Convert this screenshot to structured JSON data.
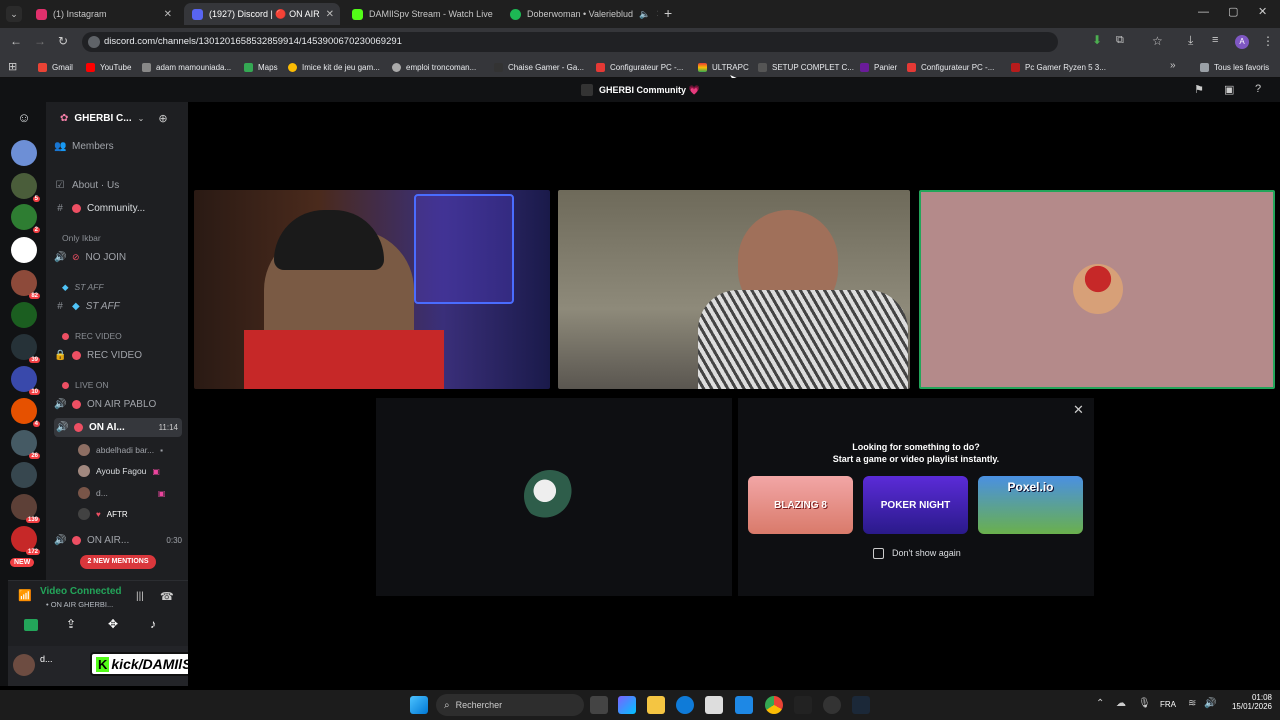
{
  "browser": {
    "tabs": [
      {
        "label": "(1) Instagram",
        "color": "#e1306c"
      },
      {
        "label": "(1927) Discord | 🔴 ON AIR",
        "color": "#5865f2"
      },
      {
        "label": "DAMIlSpv Stream - Watch Live",
        "color": "#53fc18"
      },
      {
        "label": "Doberwoman • Valerieblud",
        "color": "#1db954"
      }
    ],
    "url": "discord.com/channels/1301201658532859914/1453900670230069291",
    "bookmarks": [
      "Gmail",
      "YouTube",
      "adam mamouniada...",
      "Maps",
      "Imice kit de jeu gam...",
      "emploi troncoman...",
      "Chaise Gamer - Ga...",
      "Configurateur PC -...",
      "ULTRAPC",
      "SETUP COMPLET C...",
      "Panier",
      "Configurateur PC -...",
      "Pc Gamer Ryzen 5 3..."
    ],
    "favorites_label": "Tous les favoris"
  },
  "discord": {
    "server_title": "GHERBI Community 💗",
    "server_short": "GHERBI C...",
    "guild_badges": [
      "5",
      "2",
      "82",
      "39",
      "10",
      "4",
      "26",
      "139",
      "172",
      "NEW"
    ],
    "channels": {
      "members": "Members",
      "about": "About · Us",
      "community": "Community...",
      "cat_only": "Only Ikbar",
      "no_join": "NO JOIN",
      "cat_staff": "ST AFF",
      "staff": "ST AFF",
      "cat_rec": "REC VIDEO",
      "rec_video": "REC VIDEO",
      "cat_live": "LIVE ON",
      "on_air_pablo": "ON AIR PABLO",
      "on_air_active": "ON AI...",
      "on_air_active_time": "11:14",
      "user1": "abdelhadi bar...",
      "user2": "Ayoub Fagou",
      "user3": "d...",
      "user4": "AFTR",
      "on_air_2": "ON AIR...",
      "on_air_2_time": "0:30",
      "mentions": "2 NEW MENTIONS"
    },
    "voice": {
      "status": "Video Connected",
      "channel": "• ON AIR GHERBI..."
    },
    "user_short": "d...",
    "overlay_text": "kick/DAMIlSpv",
    "activity": {
      "title": "Looking for something to do?",
      "subtitle": "Start a game or video playlist instantly.",
      "games": [
        "BLAZING 8",
        "POKER NIGHT",
        "Poxel.io"
      ],
      "dont_show": "Don't show again"
    }
  },
  "taskbar": {
    "search": "Rechercher",
    "lang": "FRA",
    "time": "01:08",
    "date": "15/01/2026"
  }
}
